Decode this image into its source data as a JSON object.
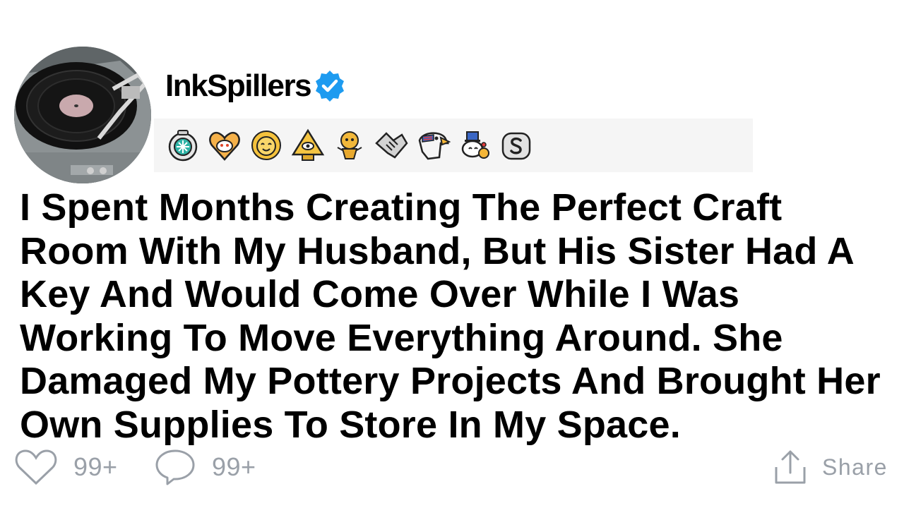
{
  "post": {
    "username": "InkSpillers",
    "verified_icon": "verified-check-icon",
    "title": "I Spent Months Creating The Perfect Craft Room With My Husband, But His Sister Had A Key And Would Come Over While I Was Working To Move Everything Around. She Damaged My Pottery Projects And Brought Her Own Supplies To Store In My Space."
  },
  "badges": [
    "ring-badge-icon",
    "heart-face-badge-icon",
    "sun-face-badge-icon",
    "pyramid-eye-badge-icon",
    "gold-trophy-badge-icon",
    "handshake-badge-icon",
    "eagle-badge-icon",
    "snoo-uncle-sam-badge-icon",
    "silver-s-badge-icon"
  ],
  "actions": {
    "like_count": "99+",
    "comment_count": "99+",
    "share_label": "Share"
  },
  "colors": {
    "verified_blue": "#1d9bf0",
    "action_gray": "#9aa0a8",
    "badge_bar": "#f5f5f5"
  }
}
